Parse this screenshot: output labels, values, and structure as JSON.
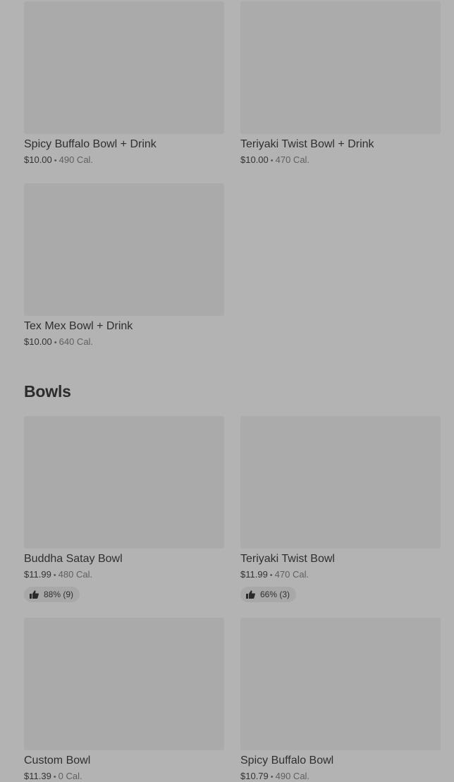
{
  "combos": [
    {
      "name": "Spicy Buffalo Bowl + Drink",
      "price": "$10.00",
      "sep": "•",
      "cal": "490 Cal."
    },
    {
      "name": "Teriyaki Twist Bowl + Drink",
      "price": "$10.00",
      "sep": "•",
      "cal": "470 Cal."
    },
    {
      "name": "Tex Mex Bowl + Drink",
      "price": "$10.00",
      "sep": "•",
      "cal": "640 Cal."
    }
  ],
  "bowls_section": {
    "title": "Bowls",
    "items": [
      {
        "name": "Buddha Satay Bowl",
        "price": "$11.99",
        "sep": "•",
        "cal": "480 Cal.",
        "rating": "88% (9)"
      },
      {
        "name": "Teriyaki Twist Bowl",
        "price": "$11.99",
        "sep": "•",
        "cal": "470 Cal.",
        "rating": "66% (3)"
      },
      {
        "name": "Custom Bowl",
        "price": "$11.39",
        "sep": "•",
        "cal": "0 Cal."
      },
      {
        "name": "Spicy Buffalo Bowl",
        "price": "$10.79",
        "sep": "•",
        "cal": "490 Cal."
      }
    ]
  },
  "icons": {
    "rating": "thumbs-up-icon"
  }
}
